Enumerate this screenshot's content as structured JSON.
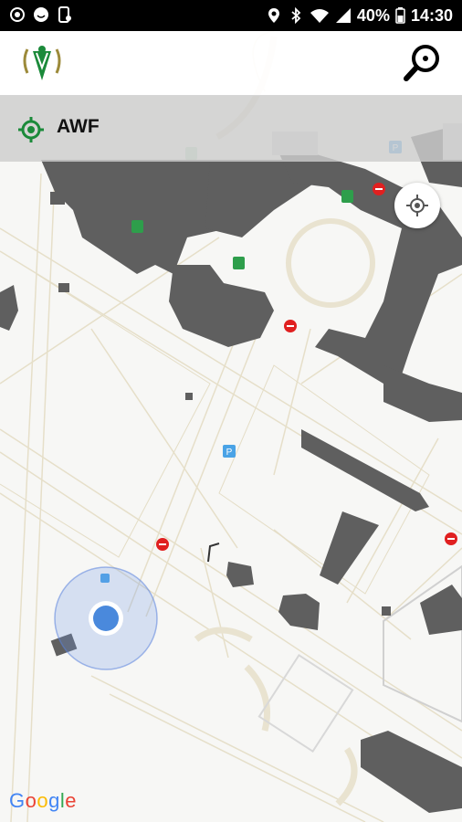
{
  "status_bar": {
    "battery": "40%",
    "time": "14:30"
  },
  "app_bar": {
    "logo_icon": "awf-crest-logo",
    "search_icon": "search-icon"
  },
  "place_bar": {
    "icon": "target-icon",
    "label": "AWF"
  },
  "map": {
    "attribution": "Google",
    "my_location_button_icon": "my-location-icon"
  },
  "colors": {
    "building": "#5f5f5f",
    "road_edge": "#e4ddc6",
    "accent_green": "#1b8a3a",
    "location_blue": "#4a89dc"
  }
}
